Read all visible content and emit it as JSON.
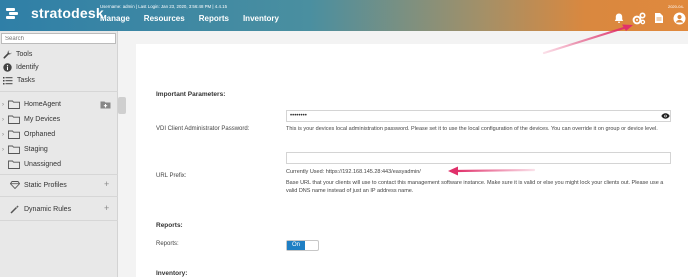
{
  "header": {
    "logo_text": "stratodesk",
    "user_info": "Username: admin | Last Login: Jan 23, 2020, 3:56:48 PM |  4.4.15",
    "date_text": "2020-04-",
    "nav": [
      "Manage",
      "Resources",
      "Reports",
      "Inventory"
    ],
    "icons": [
      "bell-icon",
      "cogs-icon",
      "document-icon",
      "user-circle-icon"
    ]
  },
  "sidebar": {
    "search_placeholder": "Search",
    "links": [
      {
        "label": "Tools",
        "icon": "wrench-icon"
      },
      {
        "label": "Identify",
        "icon": "info-icon"
      },
      {
        "label": "Tasks",
        "icon": "list-icon"
      }
    ],
    "tree": [
      {
        "label": "HomeAgent",
        "expandable": true
      },
      {
        "label": "My Devices",
        "expandable": true
      },
      {
        "label": "Orphaned",
        "expandable": true
      },
      {
        "label": "Staging",
        "expandable": true
      },
      {
        "label": "Unassigned",
        "expandable": false
      }
    ],
    "sections": [
      {
        "label": "Static Profiles",
        "icon": "diamond-icon"
      },
      {
        "label": "Dynamic Rules",
        "icon": "magic-wand-icon"
      }
    ]
  },
  "content": {
    "important_heading": "Important Parameters:",
    "vdi_label": "VDI Client Administrator Password:",
    "vdi_value": "••••••••",
    "vdi_help": "This is your devices local administration password. Please set it to use the local configuration of the devices. You can override it on group or device level.",
    "url_label": "URL Prefix:",
    "url_value": "",
    "url_current": "Currently Used: https://192.168.145.28:443/easyadmin/",
    "url_help": "Base URL that your clients will use to contact this management software instance. Make sure it is valid or else you might lock your clients out. Please use a valid DNS name instead of just an IP address name.",
    "reports_heading": "Reports:",
    "reports_label": "Reports:",
    "reports_toggle": "On",
    "inventory_heading": "Inventory:"
  },
  "colors": {
    "header_start": "#2f7fa7",
    "header_end": "#e0893d",
    "toggle_on": "#1f7fc4",
    "annotation_arrow": "#e0306a"
  }
}
